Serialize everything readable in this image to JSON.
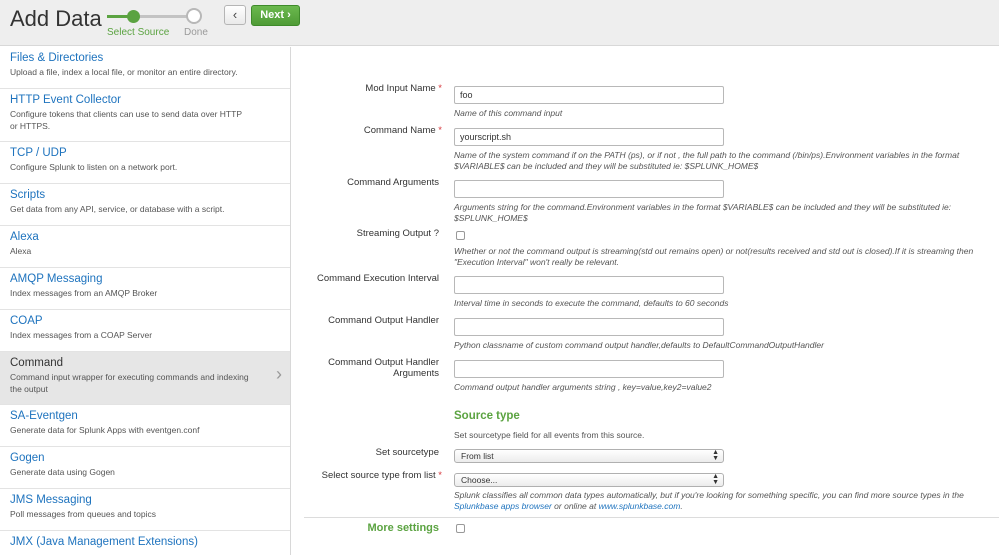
{
  "header": {
    "title": "Add Data",
    "steps": [
      "Select Source",
      "Done"
    ],
    "back_label": "‹",
    "next_label": "Next ›"
  },
  "sidebar": {
    "items": [
      {
        "title": "Files & Directories",
        "desc": "Upload a file, index a local file, or monitor an entire directory."
      },
      {
        "title": "HTTP Event Collector",
        "desc": "Configure tokens that clients can use to send data over HTTP or HTTPS."
      },
      {
        "title": "TCP / UDP",
        "desc": "Configure Splunk to listen on a network port."
      },
      {
        "title": "Scripts",
        "desc": "Get data from any API, service, or database with a script."
      },
      {
        "title": "Alexa",
        "desc": "Alexa"
      },
      {
        "title": "AMQP Messaging",
        "desc": "Index messages from an AMQP Broker"
      },
      {
        "title": "COAP",
        "desc": "Index messages from a COAP Server"
      },
      {
        "title": "Command",
        "desc": "Command input wrapper for executing commands and indexing the output"
      },
      {
        "title": "SA-Eventgen",
        "desc": "Generate data for Splunk Apps with eventgen.conf"
      },
      {
        "title": "Gogen",
        "desc": "Generate data using Gogen"
      },
      {
        "title": "JMS Messaging",
        "desc": "Poll messages from queues and topics"
      },
      {
        "title": "JMX (Java Management Extensions)",
        "desc": ""
      }
    ]
  },
  "form": {
    "mod_input_name": {
      "label": "Mod Input Name",
      "value": "foo",
      "help": "Name of this command input"
    },
    "command_name": {
      "label": "Command Name",
      "value": "yourscript.sh",
      "help": "Name of the system command if on the PATH (ps), or if not , the full path to the command (/bin/ps).Environment variables in the format $VARIABLE$ can be included and they will be substituted ie: $SPLUNK_HOME$"
    },
    "command_arguments": {
      "label": "Command Arguments",
      "value": "",
      "help": "Arguments string for the command.Environment variables in the format $VARIABLE$ can be included and they will be substituted ie: $SPLUNK_HOME$"
    },
    "streaming_output": {
      "label": "Streaming Output ?",
      "help": "Whether or not the command output is streaming(std out remains open) or not(results received and std out is closed).If it is streaming then \"Execution Interval\" won't really be relevant."
    },
    "execution_interval": {
      "label": "Command Execution Interval",
      "value": "",
      "help": "Interval time in seconds to execute the command, defaults to 60 seconds"
    },
    "output_handler": {
      "label": "Command Output Handler",
      "value": "",
      "help": "Python classname of custom command output handler,defaults to DefaultCommandOutputHandler"
    },
    "output_handler_args": {
      "label_line1": "Command Output Handler",
      "label_line2": "Arguments",
      "value": "",
      "help": "Command output handler arguments string , key=value,key2=value2"
    },
    "source_type": {
      "title": "Source type",
      "desc": "Set sourcetype field for all events from this source.",
      "set_label": "Set sourcetype",
      "set_value": "From list",
      "select_label": "Select source type from list",
      "select_value": "Choose...",
      "help_pre": "Splunk classifies all common data types automatically, but if you're looking for something specific, you can find more source types in the",
      "help_link1": "Splunkbase apps browser",
      "help_mid": " or online at ",
      "help_link2": "www.splunkbase.com",
      "help_end": "."
    },
    "more_settings": "More settings",
    "required_mark": "*"
  },
  "colors": {
    "accent_green": "#5ba341",
    "link_blue": "#1e73be",
    "required_red": "#d6363b"
  }
}
